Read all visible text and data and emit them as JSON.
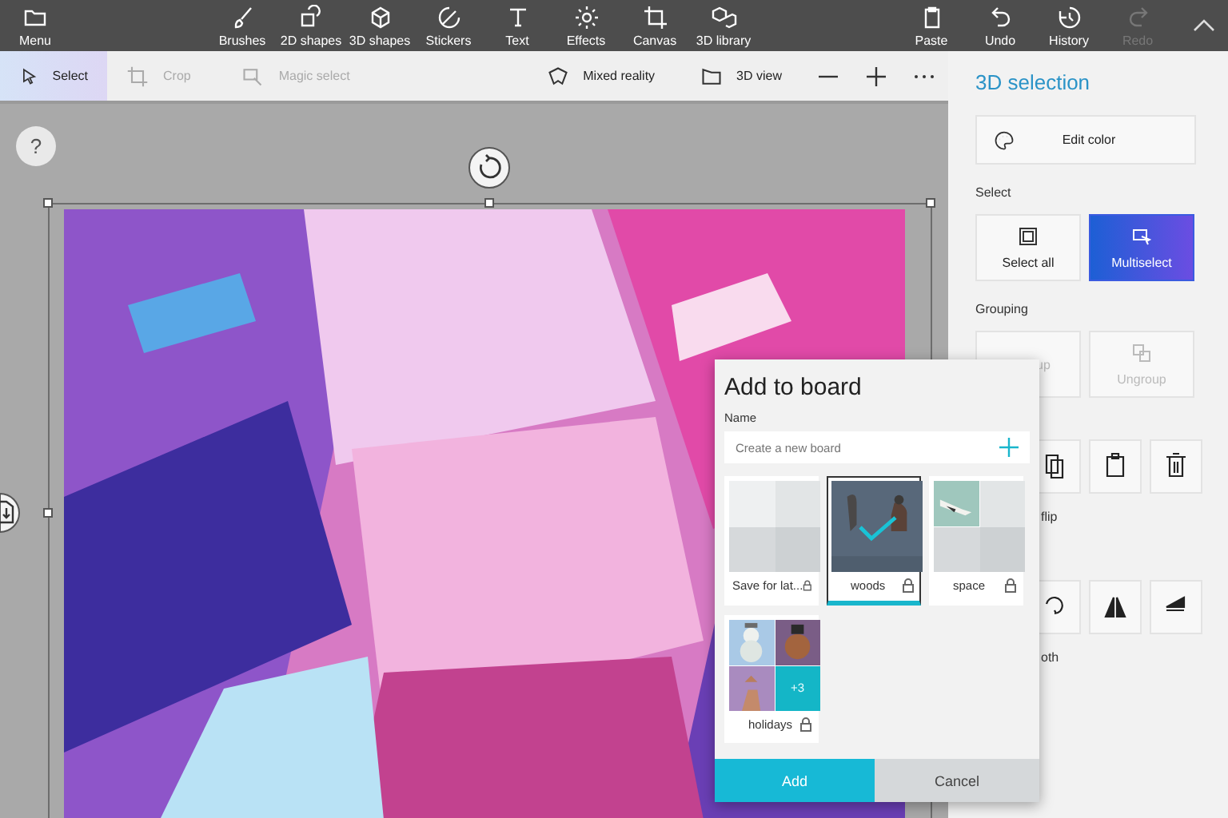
{
  "ribbon": {
    "menu": "Menu",
    "tools": [
      {
        "label": "Brushes"
      },
      {
        "label": "2D shapes"
      },
      {
        "label": "3D shapes"
      },
      {
        "label": "Stickers"
      },
      {
        "label": "Text"
      },
      {
        "label": "Effects"
      },
      {
        "label": "Canvas"
      },
      {
        "label": "3D library"
      }
    ],
    "history": [
      {
        "label": "Paste",
        "disabled": false
      },
      {
        "label": "Undo",
        "disabled": false
      },
      {
        "label": "History",
        "disabled": false
      },
      {
        "label": "Redo",
        "disabled": true
      }
    ]
  },
  "toolbar": {
    "tools": [
      {
        "label": "Select",
        "selected": true,
        "disabled": false
      },
      {
        "label": "Crop",
        "selected": false,
        "disabled": true
      },
      {
        "label": "Magic select",
        "selected": false,
        "disabled": true
      }
    ],
    "view_tools": [
      {
        "label": "Mixed reality"
      },
      {
        "label": "3D view"
      }
    ]
  },
  "help": "?",
  "panel": {
    "title": "3D selection",
    "edit_color": "Edit color",
    "select_label": "Select",
    "select_buttons": [
      {
        "label": "Select all",
        "selected": false
      },
      {
        "label": "Multiselect",
        "selected": true
      }
    ],
    "grouping_label": "Grouping",
    "group_buttons": [
      {
        "label": "up",
        "disabled": true
      },
      {
        "label": "Ungroup",
        "disabled": true
      }
    ],
    "flip_label": "flip",
    "smooth_label": "oth"
  },
  "dialog": {
    "title": "Add to board",
    "name_label": "Name",
    "placeholder": "Create a new board",
    "boards": [
      {
        "name": "Save for lat...",
        "selected": false,
        "locked": true,
        "kind": "empty"
      },
      {
        "name": "woods",
        "selected": true,
        "locked": true,
        "kind": "full"
      },
      {
        "name": "space",
        "selected": false,
        "locked": true,
        "kind": "one"
      },
      {
        "name": "holidays",
        "selected": false,
        "locked": true,
        "kind": "three",
        "more": "+3"
      }
    ],
    "add": "Add",
    "cancel": "Cancel"
  }
}
